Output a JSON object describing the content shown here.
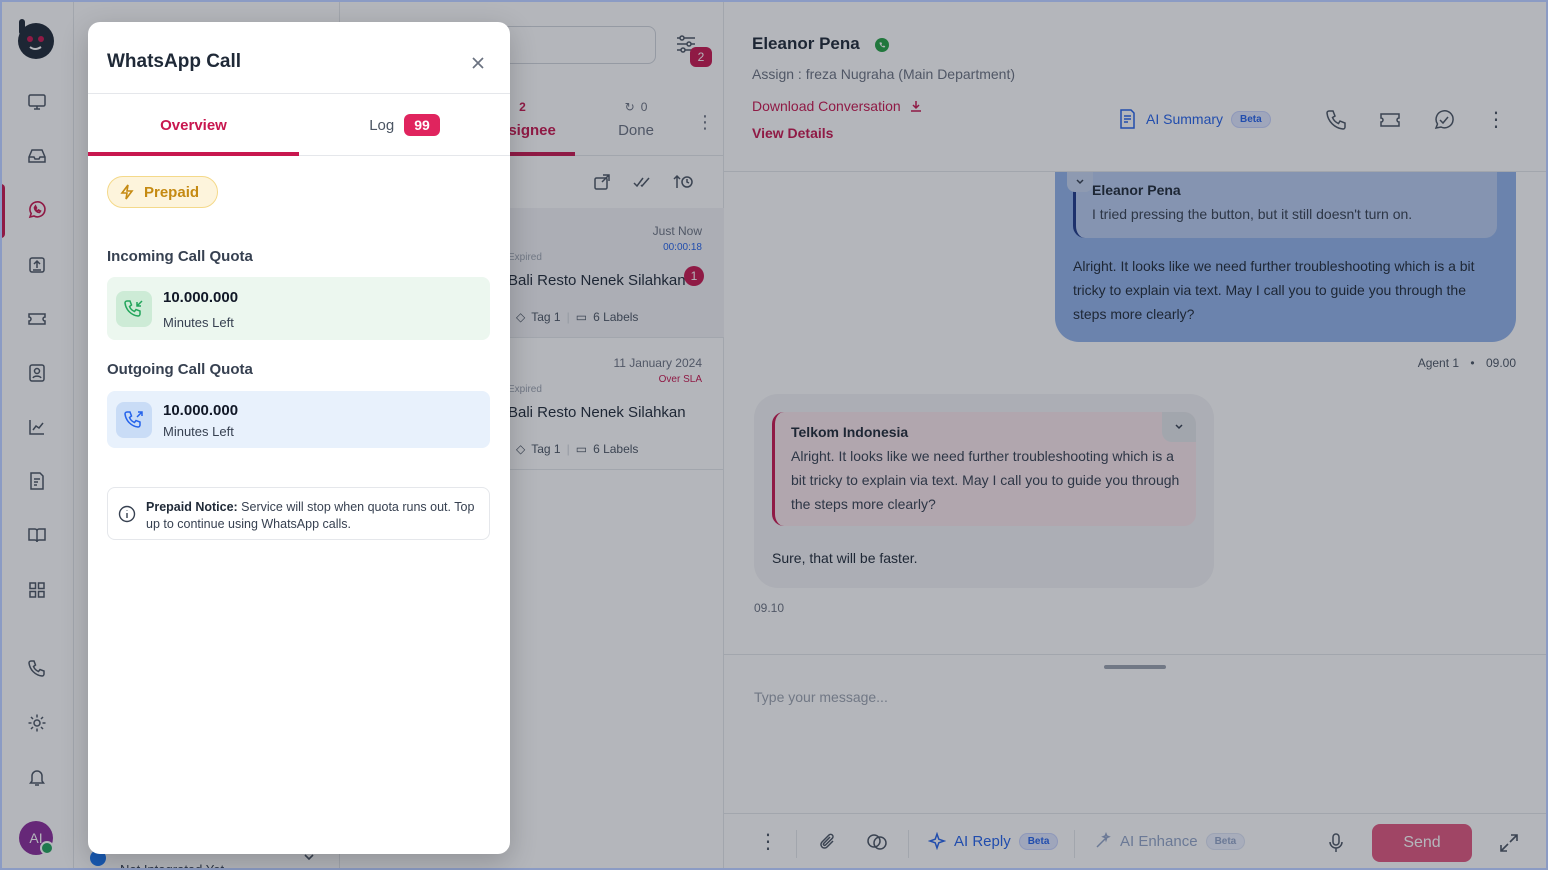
{
  "list": {
    "search_placeholder": "...",
    "filter_count": "2",
    "tabs": [
      {
        "count": "2",
        "label": "Assignee"
      },
      {
        "count": "0",
        "label": "Done"
      }
    ],
    "conversations": [
      {
        "time": "Just Now",
        "sub": "00:00:18",
        "status": "Expired",
        "name": "Bali Resto Nenek Silahkan",
        "tag": "Tag 1",
        "labels": "6 Labels",
        "unread": "1"
      },
      {
        "time": "11 January 2024",
        "sub": "Over SLA",
        "status": "Expired",
        "name": "Bali Resto Nenek Silahkan",
        "tag": "Tag 1",
        "labels": "6 Labels"
      }
    ],
    "bottom_text": "Not Integrated Yet"
  },
  "chat": {
    "contact_name": "Eleanor Pena",
    "assign": "Assign : freza Nugraha (Main Department)",
    "download": "Download Conversation",
    "view_details": "View Details",
    "ai_summary": "AI Summary",
    "beta": "Beta",
    "outgoing": {
      "quote_name": "Eleanor Pena",
      "quote_text": "I tried pressing the button, but it still doesn't turn on.",
      "text": "Alright. It looks like we need further troubleshooting which is a bit tricky to explain via text. May I call you to guide you through the steps more clearly?",
      "agent": "Agent 1",
      "time": "09.00"
    },
    "incoming": {
      "quote_name": "Telkom Indonesia",
      "quote_text": "Alright. It looks like we need further troubleshooting which is a bit tricky to explain via text. May I call you to guide you through the steps more clearly?",
      "text": "Sure, that will be faster.",
      "time": "09.10"
    },
    "composer_placeholder": "Type your message...",
    "ai_reply": "AI Reply",
    "ai_enhance": "AI Enhance",
    "send": "Send"
  },
  "user": {
    "initials": "AI"
  },
  "modal": {
    "title": "WhatsApp Call",
    "tabs": {
      "overview": "Overview",
      "log": "Log",
      "log_count": "99"
    },
    "plan_badge": "Prepaid",
    "incoming": {
      "title": "Incoming Call Quota",
      "value": "10.000.000",
      "unit": "Minutes Left"
    },
    "outgoing": {
      "title": "Outgoing Call Quota",
      "value": "10.000.000",
      "unit": "Minutes Left"
    },
    "notice": {
      "label": "Prepaid Notice:",
      "text": " Service will stop when quota runs out. Top up to continue using WhatsApp calls."
    }
  },
  "colors": {
    "brand": "#c8174f",
    "whatsapp": "#25a244",
    "link_blue": "#2563eb",
    "prepaid": "#c58a12"
  }
}
